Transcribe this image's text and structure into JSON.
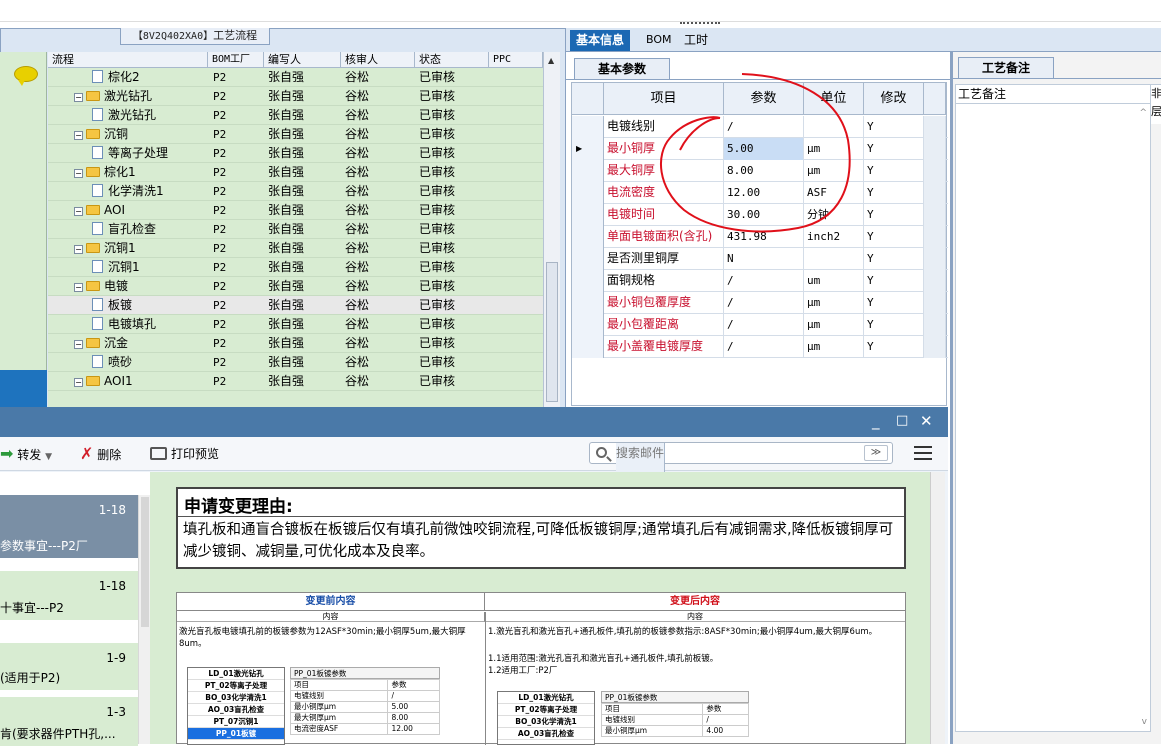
{
  "left_panel": {
    "caption_code": "【8V2Q402XA0】",
    "caption_text": "工艺流程",
    "columns": [
      "流程",
      "BOM工厂",
      "编写人",
      "核审人",
      "状态",
      "PPC"
    ],
    "rows": [
      {
        "kind": "doc",
        "name": "棕化2",
        "factory": "P2",
        "writer": "张自强",
        "reviewer": "谷松",
        "status": "已审核"
      },
      {
        "kind": "folder",
        "name": "激光钻孔",
        "factory": "P2",
        "writer": "张自强",
        "reviewer": "谷松",
        "status": "已审核"
      },
      {
        "kind": "doc",
        "name": "激光钻孔",
        "factory": "P2",
        "writer": "张自强",
        "reviewer": "谷松",
        "status": "已审核"
      },
      {
        "kind": "folder",
        "name": "沉铜",
        "factory": "P2",
        "writer": "张自强",
        "reviewer": "谷松",
        "status": "已审核"
      },
      {
        "kind": "doc",
        "name": "等离子处理",
        "factory": "P2",
        "writer": "张自强",
        "reviewer": "谷松",
        "status": "已审核"
      },
      {
        "kind": "folder",
        "name": "棕化1",
        "factory": "P2",
        "writer": "张自强",
        "reviewer": "谷松",
        "status": "已审核"
      },
      {
        "kind": "doc",
        "name": "化学清洗1",
        "factory": "P2",
        "writer": "张自强",
        "reviewer": "谷松",
        "status": "已审核"
      },
      {
        "kind": "folder",
        "name": "AOI",
        "factory": "P2",
        "writer": "张自强",
        "reviewer": "谷松",
        "status": "已审核"
      },
      {
        "kind": "doc",
        "name": "盲孔检查",
        "factory": "P2",
        "writer": "张自强",
        "reviewer": "谷松",
        "status": "已审核"
      },
      {
        "kind": "folder",
        "name": "沉铜1",
        "factory": "P2",
        "writer": "张自强",
        "reviewer": "谷松",
        "status": "已审核"
      },
      {
        "kind": "doc",
        "name": "沉铜1",
        "factory": "P2",
        "writer": "张自强",
        "reviewer": "谷松",
        "status": "已审核"
      },
      {
        "kind": "folder",
        "name": "电镀",
        "factory": "P2",
        "writer": "张自强",
        "reviewer": "谷松",
        "status": "已审核"
      },
      {
        "kind": "doc",
        "name": "板镀",
        "factory": "P2",
        "writer": "张自强",
        "reviewer": "谷松",
        "status": "已审核",
        "selected": true
      },
      {
        "kind": "doc",
        "name": "电镀填孔",
        "factory": "P2",
        "writer": "张自强",
        "reviewer": "谷松",
        "status": "已审核"
      },
      {
        "kind": "folder",
        "name": "沉金",
        "factory": "P2",
        "writer": "张自强",
        "reviewer": "谷松",
        "status": "已审核"
      },
      {
        "kind": "doc",
        "name": "喷砂",
        "factory": "P2",
        "writer": "张自强",
        "reviewer": "谷松",
        "status": "已审核"
      },
      {
        "kind": "folder",
        "name": "AOI1",
        "factory": "P2",
        "writer": "张自强",
        "reviewer": "谷松",
        "status": "已审核"
      }
    ]
  },
  "right_tabs": [
    "基本信息",
    "BOM",
    "工时"
  ],
  "params": {
    "subtab": "基本参数",
    "columns": [
      "项目",
      "参数",
      "单位",
      "修改"
    ],
    "rows": [
      {
        "item": "电镀线别",
        "value": "/",
        "unit": "",
        "edit": "Y",
        "red": false
      },
      {
        "item": "最小铜厚",
        "value": "5.00",
        "unit": "μm",
        "edit": "Y",
        "red": true,
        "current": true
      },
      {
        "item": "最大铜厚",
        "value": "8.00",
        "unit": "μm",
        "edit": "Y",
        "red": true
      },
      {
        "item": "电流密度",
        "value": "12.00",
        "unit": "ASF",
        "edit": "Y",
        "red": true
      },
      {
        "item": "电镀时间",
        "value": "30.00",
        "unit": "分钟",
        "edit": "Y",
        "red": true
      },
      {
        "item": "单面电镀面积(含孔)",
        "value": "431.98",
        "unit": "inch2",
        "edit": "Y",
        "red": true
      },
      {
        "item": "是否测里铜厚",
        "value": "N",
        "unit": "",
        "edit": "Y",
        "red": false
      },
      {
        "item": "面铜规格",
        "value": "/",
        "unit": "um",
        "edit": "Y",
        "red": false
      },
      {
        "item": "最小铜包覆厚度",
        "value": "/",
        "unit": "μm",
        "edit": "Y",
        "red": true
      },
      {
        "item": "最小包覆距离",
        "value": "/",
        "unit": "μm",
        "edit": "Y",
        "red": true
      },
      {
        "item": "最小盖覆电镀厚度",
        "value": "/",
        "unit": "μm",
        "edit": "Y",
        "red": true
      }
    ]
  },
  "notes": {
    "tab": "工艺备注",
    "header": "工艺备注",
    "extra_header": "非",
    "extra_cell": "层"
  },
  "mail": {
    "toolbar": {
      "forward": "转发",
      "delete": "删除",
      "print": "打印预览"
    },
    "search_placeholder": "搜索邮件",
    "list": [
      {
        "date": "1-18",
        "text": "参数事宜---P2厂",
        "selected": true
      },
      {
        "date": "1-18",
        "text": "十事宜---P2"
      },
      {
        "date": "1-9",
        "text": "(适用于P2)"
      },
      {
        "date": "1-3",
        "text": "肯(要求器件PTH孔,..."
      }
    ],
    "reason_title": "申请变更理由:",
    "reason_text": "填孔板和通盲合镀板在板镀后仅有填孔前微蚀咬铜流程,可降低板镀铜厚;通常填孔后有减铜需求,降低板镀铜厚可减少镀铜、减铜量,可优化成本及良率。",
    "before_title": "变更前内容",
    "after_title": "变更后内容",
    "content_label": "内容",
    "before_text": "激光盲孔板电镀填孔前的板镀参数为12ASF*30min;最小铜厚5um,最大铜厚8um。",
    "after_text_1": "1.激光盲孔和激光盲孔+通孔板件,填孔前的板镀参数指示:8ASF*30min;最小铜厚4um,最大铜厚6um。",
    "after_text_2": "1.1适用范围:激光孔盲孔和激光盲孔+通孔板件,填孔前板镀。",
    "after_text_3": "1.2适用工厂:P2厂",
    "before_steps": [
      "LD_01激光钻孔",
      "PT_02等离子处理",
      "BO_03化学清洗1",
      "AO_03盲孔检查",
      "PT_07沉铜1",
      "PP_01板镀"
    ],
    "after_steps": [
      "LD_01激光钻孔",
      "PT_02等离子处理",
      "BO_03化学清洗1",
      "AO_03盲孔检查"
    ],
    "mini_caption": "PP_01板镀参数",
    "mini_head": [
      "项目",
      "参数"
    ],
    "mini_before": [
      [
        "电镀线别",
        "/"
      ],
      [
        "最小铜厚μm",
        "5.00"
      ],
      [
        "最大铜厚μm",
        "8.00"
      ],
      [
        "电流密度ASF",
        "12.00"
      ]
    ],
    "mini_after": [
      [
        "电镀线别",
        "/"
      ],
      [
        "最小铜厚μm",
        "4.00"
      ]
    ]
  }
}
